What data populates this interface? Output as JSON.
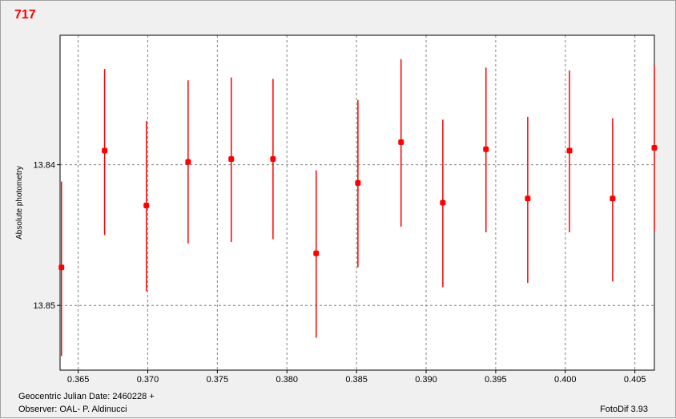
{
  "header": {
    "title": "717"
  },
  "footer": {
    "jd_label": "Geocentric Julian Date: 2460228 +",
    "observer": "Observer: OAL- P. Aldinucci",
    "software": "FotoDif 3.93"
  },
  "chart_data": {
    "type": "scatter",
    "title": "717",
    "xlabel": "",
    "ylabel": "Absolute photometry",
    "xlim": [
      0.3637,
      0.4064
    ],
    "ylim": [
      13.8308,
      13.8546
    ],
    "y_inverted": true,
    "grid": true,
    "x_ticks": [
      0.365,
      0.37,
      0.375,
      0.38,
      0.385,
      0.39,
      0.395,
      0.4,
      0.405
    ],
    "x_tick_labels": [
      "0.365",
      "0.370",
      "0.375",
      "0.380",
      "0.385",
      "0.390",
      "0.395",
      "0.400",
      "0.405"
    ],
    "y_ticks": [
      13.84,
      13.85
    ],
    "y_tick_labels": [
      "13.84",
      "13.85"
    ],
    "marker_color": "#ff0000",
    "points": [
      {
        "x": 0.3638,
        "y": 13.8473,
        "err_low": 13.8412,
        "err_high": 13.8536
      },
      {
        "x": 0.3669,
        "y": 13.839,
        "err_low": 13.8332,
        "err_high": 13.845
      },
      {
        "x": 0.3699,
        "y": 13.8429,
        "err_low": 13.8369,
        "err_high": 13.849
      },
      {
        "x": 0.3729,
        "y": 13.8398,
        "err_low": 13.834,
        "err_high": 13.8456
      },
      {
        "x": 0.376,
        "y": 13.8396,
        "err_low": 13.8338,
        "err_high": 13.8455
      },
      {
        "x": 0.379,
        "y": 13.8396,
        "err_low": 13.8339,
        "err_high": 13.8453
      },
      {
        "x": 0.3821,
        "y": 13.8463,
        "err_low": 13.8404,
        "err_high": 13.8523
      },
      {
        "x": 0.3851,
        "y": 13.8413,
        "err_low": 13.8354,
        "err_high": 13.8473
      },
      {
        "x": 0.3882,
        "y": 13.8384,
        "err_low": 13.8325,
        "err_high": 13.8444
      },
      {
        "x": 0.3912,
        "y": 13.8427,
        "err_low": 13.8368,
        "err_high": 13.8487
      },
      {
        "x": 0.3943,
        "y": 13.8389,
        "err_low": 13.8331,
        "err_high": 13.8448
      },
      {
        "x": 0.3973,
        "y": 13.8424,
        "err_low": 13.8366,
        "err_high": 13.8484
      },
      {
        "x": 0.4003,
        "y": 13.839,
        "err_low": 13.8333,
        "err_high": 13.8448
      },
      {
        "x": 0.4034,
        "y": 13.8424,
        "err_low": 13.8367,
        "err_high": 13.8483
      },
      {
        "x": 0.4064,
        "y": 13.8388,
        "err_low": 13.8329,
        "err_high": 13.8447
      }
    ]
  }
}
